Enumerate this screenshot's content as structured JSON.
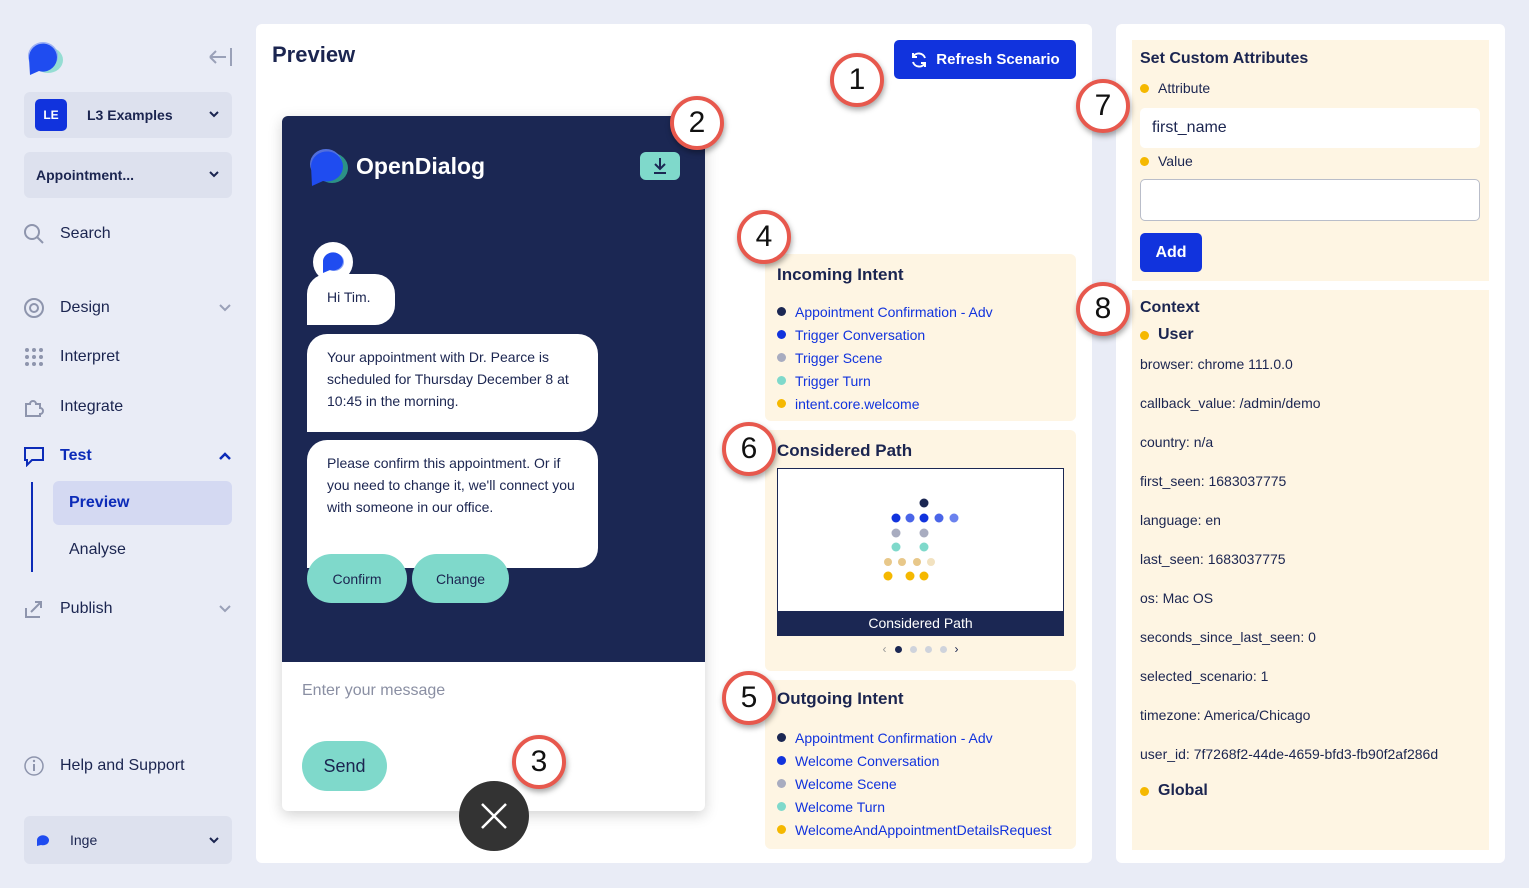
{
  "sidebar": {
    "workspace": {
      "badge": "LE",
      "name": "L3 Examples"
    },
    "scenario": {
      "name": "Appointment..."
    },
    "nav": [
      {
        "label": "Search",
        "icon": "search-icon"
      },
      {
        "label": "Design",
        "icon": "design-icon"
      },
      {
        "label": "Interpret",
        "icon": "interpret-icon"
      },
      {
        "label": "Integrate",
        "icon": "puzzle-icon"
      },
      {
        "label": "Test",
        "icon": "chat-icon"
      },
      {
        "label": "Publish",
        "icon": "publish-icon"
      }
    ],
    "test_sub": [
      {
        "label": "Preview"
      },
      {
        "label": "Analyse"
      }
    ],
    "help": {
      "label": "Help and Support",
      "icon": "info-icon"
    },
    "user": {
      "name": "Inge"
    }
  },
  "main": {
    "title": "Preview",
    "refresh_label": "Refresh Scenario",
    "widget": {
      "brand": "OpenDialog",
      "messages": [
        "Hi Tim.",
        "Your appointment with Dr. Pearce is scheduled for Thursday December 8 at 10:45 in the morning.",
        "Please confirm this appointment. Or if you need to change it, we'll connect you with someone in our office."
      ],
      "buttons": [
        "Confirm",
        "Change"
      ],
      "input_placeholder": "Enter your message",
      "send_label": "Send"
    },
    "incoming": {
      "title": "Incoming Intent",
      "items": [
        {
          "label": "Appointment Confirmation - Adv",
          "color": "#1b2753"
        },
        {
          "label": "Trigger Conversation",
          "color": "#1133dd"
        },
        {
          "label": "Trigger Scene",
          "color": "#a8acc0"
        },
        {
          "label": "Trigger Turn",
          "color": "#7fd9cb"
        },
        {
          "label": "intent.core.welcome",
          "color": "#f5b800"
        }
      ]
    },
    "considered": {
      "title": "Considered Path",
      "caption": "Considered Path"
    },
    "outgoing": {
      "title": "Outgoing Intent",
      "items": [
        {
          "label": "Appointment Confirmation - Adv",
          "color": "#1b2753"
        },
        {
          "label": "Welcome Conversation",
          "color": "#1133dd"
        },
        {
          "label": "Welcome Scene",
          "color": "#a8acc0"
        },
        {
          "label": "Welcome Turn",
          "color": "#7fd9cb"
        },
        {
          "label": "WelcomeAndAppointmentDetailsRequest",
          "color": "#f5b800"
        }
      ]
    }
  },
  "right": {
    "attributes": {
      "title": "Set Custom Attributes",
      "attribute_label": "Attribute",
      "attribute_value": "first_name",
      "value_label": "Value",
      "value_value": "",
      "add_label": "Add"
    },
    "context": {
      "title": "Context",
      "user_label": "User",
      "lines": [
        "browser: chrome 111.0.0",
        "callback_value: /admin/demo",
        "country: n/a",
        "first_seen: 1683037775",
        "language: en",
        "last_seen: 1683037775",
        "os: Mac OS",
        "seconds_since_last_seen: 0",
        "selected_scenario: 1",
        "timezone: America/Chicago",
        "user_id: 7f7268f2-44de-4659-bfd3-fb90f2af286d"
      ],
      "global_label": "Global"
    }
  },
  "markers": [
    "1",
    "2",
    "3",
    "4",
    "5",
    "6",
    "7",
    "8"
  ]
}
